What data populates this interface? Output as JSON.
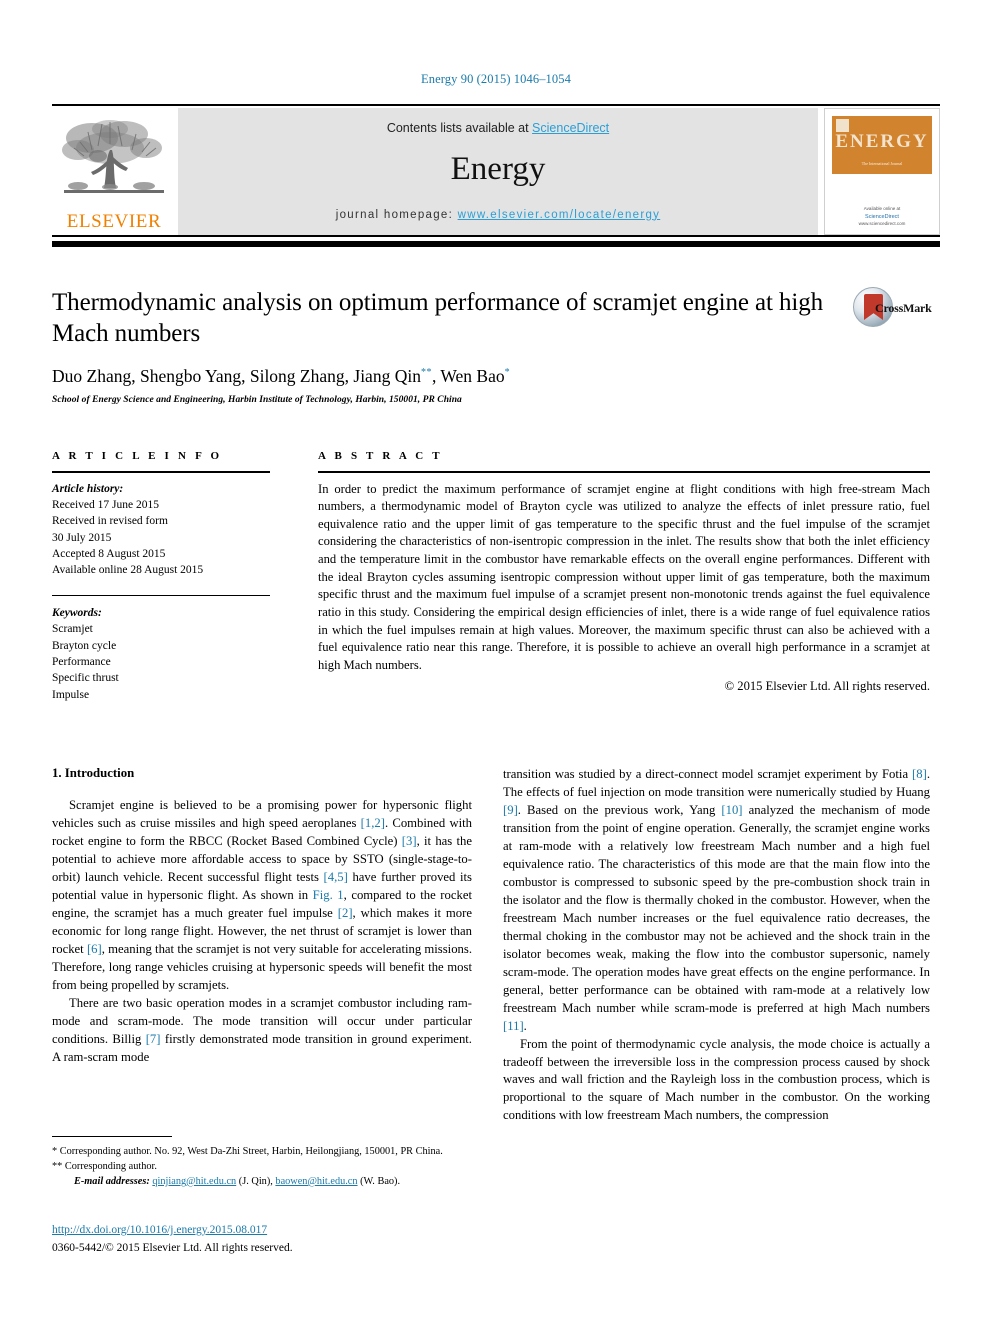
{
  "running_head": "Energy 90 (2015) 1046–1054",
  "masthead": {
    "contents_prefix": "Contents lists available at ",
    "sciencedirect": "ScienceDirect",
    "journal_name": "Energy",
    "homepage_prefix": "journal homepage: ",
    "homepage_url": "www.elsevier.com/locate/energy",
    "publisher_name": "ELSEVIER",
    "cover": {
      "title": "ENERGY",
      "subtitle": "The International Journal",
      "footer_prefix": "Available online at",
      "footer_brand": "ScienceDirect",
      "footer_url": "www.sciencedirect.com"
    }
  },
  "article": {
    "title": "Thermodynamic analysis on optimum performance of scramjet engine at high Mach numbers",
    "authors_html": "Duo Zhang, Shengbo Yang, Silong Zhang, Jiang Qin<sup>**</sup>, Wen Bao<sup>*</sup>",
    "affiliation": "School of Energy Science and Engineering, Harbin Institute of Technology, Harbin, 150001, PR China",
    "crossmark_label": "CrossMark"
  },
  "article_info": {
    "heading": "A R T I C L E   I N F O",
    "history_label": "Article history:",
    "history": [
      "Received 17 June 2015",
      "Received in revised form",
      "30 July 2015",
      "Accepted 8 August 2015",
      "Available online 28 August 2015"
    ],
    "keywords_label": "Keywords:",
    "keywords": [
      "Scramjet",
      "Brayton cycle",
      "Performance",
      "Specific thrust",
      "Impulse"
    ]
  },
  "abstract": {
    "heading": "A B S T R A C T",
    "text": "In order to predict the maximum performance of scramjet engine at flight conditions with high free-stream Mach numbers, a thermodynamic model of Brayton cycle was utilized to analyze the effects of inlet pressure ratio, fuel equivalence ratio and the upper limit of gas temperature to the specific thrust and the fuel impulse of the scramjet considering the characteristics of non-isentropic compression in the inlet. The results show that both the inlet efficiency and the temperature limit in the combustor have remarkable effects on the overall engine performances. Different with the ideal Brayton cycles assuming isentropic compression without upper limit of gas temperature, both the maximum specific thrust and the maximum fuel impulse of a scramjet present non-monotonic trends against the fuel equivalence ratio in this study. Considering the empirical design efficiencies of inlet, there is a wide range of fuel equivalence ratios in which the fuel impulses remain at high values. Moreover, the maximum specific thrust can also be achieved with a fuel equivalence ratio near this range. Therefore, it is possible to achieve an overall high performance in a scramjet at high Mach numbers.",
    "copyright": "© 2015 Elsevier Ltd. All rights reserved."
  },
  "body": {
    "section_title": "1. Introduction",
    "left_paragraphs": [
      "Scramjet engine is believed to be a promising power for hypersonic flight vehicles such as cruise missiles and high speed aeroplanes [1,2]. Combined with rocket engine to form the RBCC (Rocket Based Combined Cycle) [3], it has the potential to achieve more affordable access to space by SSTO (single-stage-to-orbit) launch vehicle. Recent successful flight tests [4,5] have further proved its potential value in hypersonic flight. As shown in Fig. 1, compared to the rocket engine, the scramjet has a much greater fuel impulse [2], which makes it more economic for long range flight. However, the net thrust of scramjet is lower than rocket [6], meaning that the scramjet is not very suitable for accelerating missions. Therefore, long range vehicles cruising at hypersonic speeds will benefit the most from being propelled by scramjets.",
      "There are two basic operation modes in a scramjet combustor including ram-mode and scram-mode. The mode transition will occur under particular conditions. Billig [7] firstly demonstrated mode transition in ground experiment. A ram-scram mode"
    ],
    "right_paragraphs": [
      "transition was studied by a direct-connect model scramjet experiment by Fotia [8]. The effects of fuel injection on mode transition were numerically studied by Huang [9]. Based on the previous work, Yang [10] analyzed the mechanism of mode transition from the point of engine operation. Generally, the scramjet engine works at ram-mode with a relatively low freestream Mach number and a high fuel equivalence ratio. The characteristics of this mode are that the main flow into the combustor is compressed to subsonic speed by the pre-combustion shock train in the isolator and the flow is thermally choked in the combustor. However, when the freestream Mach number increases or the fuel equivalence ratio decreases, the thermal choking in the combustor may not be achieved and the shock train in the isolator becomes weak, making the flow into the combustor supersonic, namely scram-mode. The operation modes have great effects on the engine performance. In general, better performance can be obtained with ram-mode at a relatively low freestream Mach number while scram-mode is preferred at high Mach numbers [11].",
      "From the point of thermodynamic cycle analysis, the mode choice is actually a tradeoff between the irreversible loss in the compression process caused by shock waves and wall friction and the Rayleigh loss in the combustion process, which is proportional to the square of Mach number in the combustor. On the working conditions with low freestream Mach numbers, the compression"
    ]
  },
  "footnotes": {
    "corresponding_1": "* Corresponding author. No. 92, West Da-Zhi Street, Harbin, Heilongjiang, 150001, PR China.",
    "corresponding_2": "** Corresponding author.",
    "email_label": "E-mail addresses:",
    "email_1": "qinjiang@hit.edu.cn",
    "email_1_owner": "(J. Qin),",
    "email_2": "baowen@hit.edu.cn",
    "email_2_owner": "(W. Bao)."
  },
  "doi": {
    "url": "http://dx.doi.org/10.1016/j.energy.2015.08.017",
    "issn_line": "0360-5442/© 2015 Elsevier Ltd. All rights reserved."
  },
  "colors": {
    "link": "#1a7aaa",
    "sciencedirect": "#2a9fd6",
    "elsevier_orange": "#f08000",
    "cover_orange": "#d2832e",
    "panel_grey": "#e3e3e3"
  }
}
